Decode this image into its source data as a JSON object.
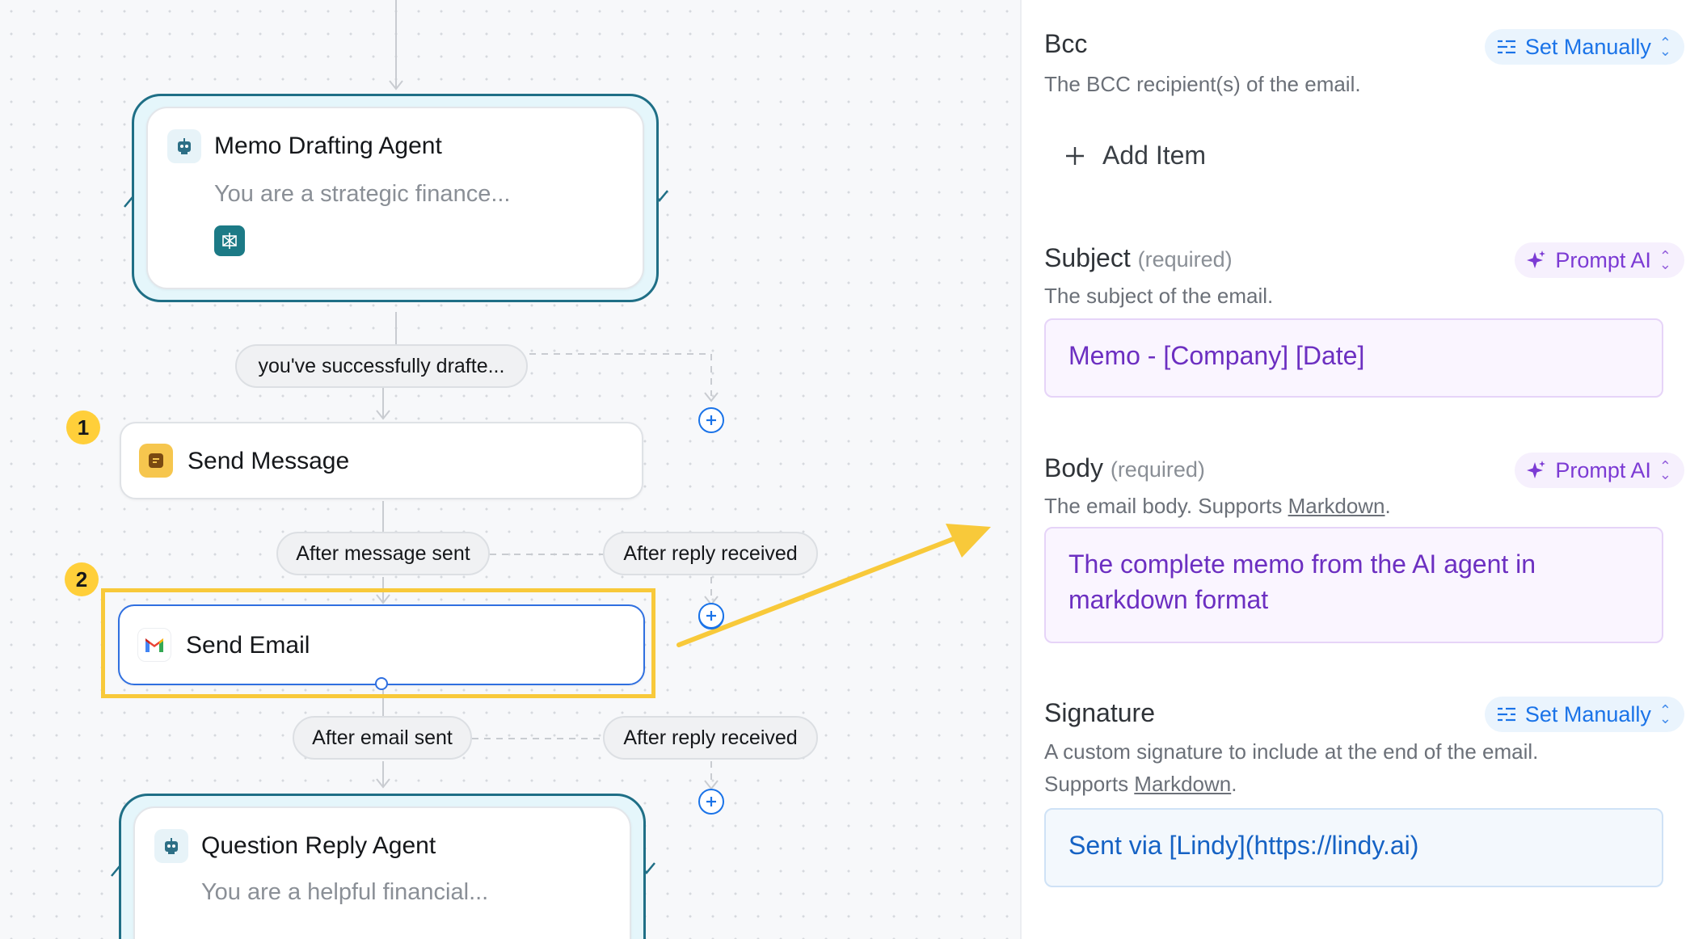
{
  "canvas": {
    "memo_agent": {
      "title": "Memo Drafting Agent",
      "subtitle": "You are a strategic finance...",
      "tool_icon": "perplexity-icon"
    },
    "condition_pill": "you've successfully drafte...",
    "steps": [
      {
        "badge": "1",
        "title": "Send Message",
        "icon": "message-icon"
      },
      {
        "badge": "2",
        "title": "Send Email",
        "icon": "gmail-icon"
      }
    ],
    "message_branches": {
      "left": "After message sent",
      "right": "After reply received"
    },
    "email_branches": {
      "left": "After email sent",
      "right": "After reply received"
    },
    "question_agent": {
      "title": "Question Reply Agent",
      "subtitle": "You are a helpful financial..."
    },
    "colors": {
      "highlight": "#f8c93a",
      "agent_border": "#1f6f86",
      "plus": "#1a73e8"
    }
  },
  "panel": {
    "bcc": {
      "label": "Bcc",
      "description": "The BCC recipient(s) of the email.",
      "mode": "Set Manually",
      "add_item": "Add Item"
    },
    "subject": {
      "label": "Subject",
      "required": "(required)",
      "description": "The subject of the email.",
      "mode": "Prompt AI",
      "value": "Memo - [Company] [Date]"
    },
    "body": {
      "label": "Body",
      "required": "(required)",
      "description_prefix": "The email body. Supports ",
      "description_link": "Markdown",
      "description_suffix": ".",
      "mode": "Prompt AI",
      "value": "The complete memo from the AI agent in markdown format"
    },
    "signature": {
      "label": "Signature",
      "description_line1": "A custom signature to include at the end of the email.",
      "description_prefix": "Supports ",
      "description_link": "Markdown",
      "description_suffix": ".",
      "mode": "Set Manually",
      "value": "Sent via [Lindy](https://lindy.ai)"
    }
  }
}
